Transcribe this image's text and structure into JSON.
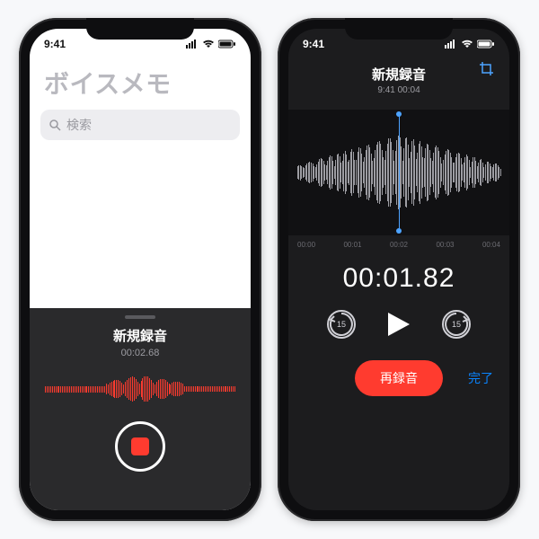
{
  "status": {
    "time": "9:41"
  },
  "left": {
    "app_title": "ボイスメモ",
    "search_placeholder": "検索",
    "recording_title": "新規録音",
    "recording_time": "00:02.68"
  },
  "right": {
    "title": "新規録音",
    "subtitle": "9:41  00:04",
    "ruler": [
      "00:00",
      "00:01",
      "00:02",
      "00:03",
      "00:04"
    ],
    "elapsed": "00:01.82",
    "skip_seconds": "15",
    "re_record_label": "再録音",
    "done_label": "完了"
  },
  "colors": {
    "accent_red": "#ff3b2f",
    "accent_blue": "#0a84ff",
    "panel_dark": "#2a2a2c",
    "screen_dark": "#1c1c1e"
  }
}
